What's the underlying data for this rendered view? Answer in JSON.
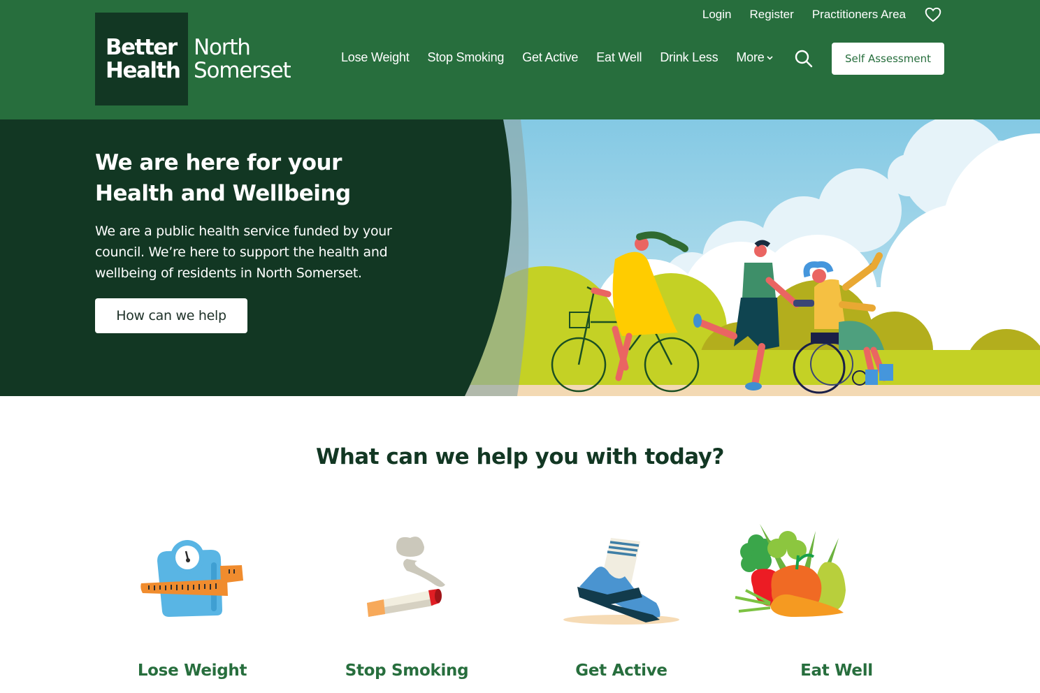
{
  "brand": {
    "logo_line1": "Better",
    "logo_line2": "Health",
    "region_line1": "North",
    "region_line2": "Somerset",
    "colors": {
      "header_green": "#276e3d",
      "dark_green": "#123723",
      "white": "#ffffff"
    }
  },
  "utility_nav": {
    "login": "Login",
    "register": "Register",
    "practitioners": "Practitioners Area",
    "favourites_icon": "heart-icon"
  },
  "main_nav": {
    "items": [
      "Lose Weight",
      "Stop Smoking",
      "Get Active",
      "Eat Well",
      "Drink Less"
    ],
    "more_label": "More",
    "more_icon": "chevron-down-icon",
    "search_icon": "search-icon",
    "self_assessment": "Self Assessment"
  },
  "hero": {
    "title_line1": "We are here for your",
    "title_line2": "Health and Wellbeing",
    "body": "We are a public health service funded by your council. We’re here to support the health and wellbeing of residents in North Somerset.",
    "cta": "How can we help",
    "illustration": "people-cycling-running-wheelchair-illustration"
  },
  "help_section": {
    "title": "What can we help you with today?",
    "cards": [
      {
        "label": "Lose Weight",
        "icon": "scale-tape-measure-icon"
      },
      {
        "label": "Stop Smoking",
        "icon": "cigarette-icon"
      },
      {
        "label": "Get Active",
        "icon": "trainer-shoe-icon"
      },
      {
        "label": "Eat Well",
        "icon": "vegetables-icon"
      }
    ]
  }
}
